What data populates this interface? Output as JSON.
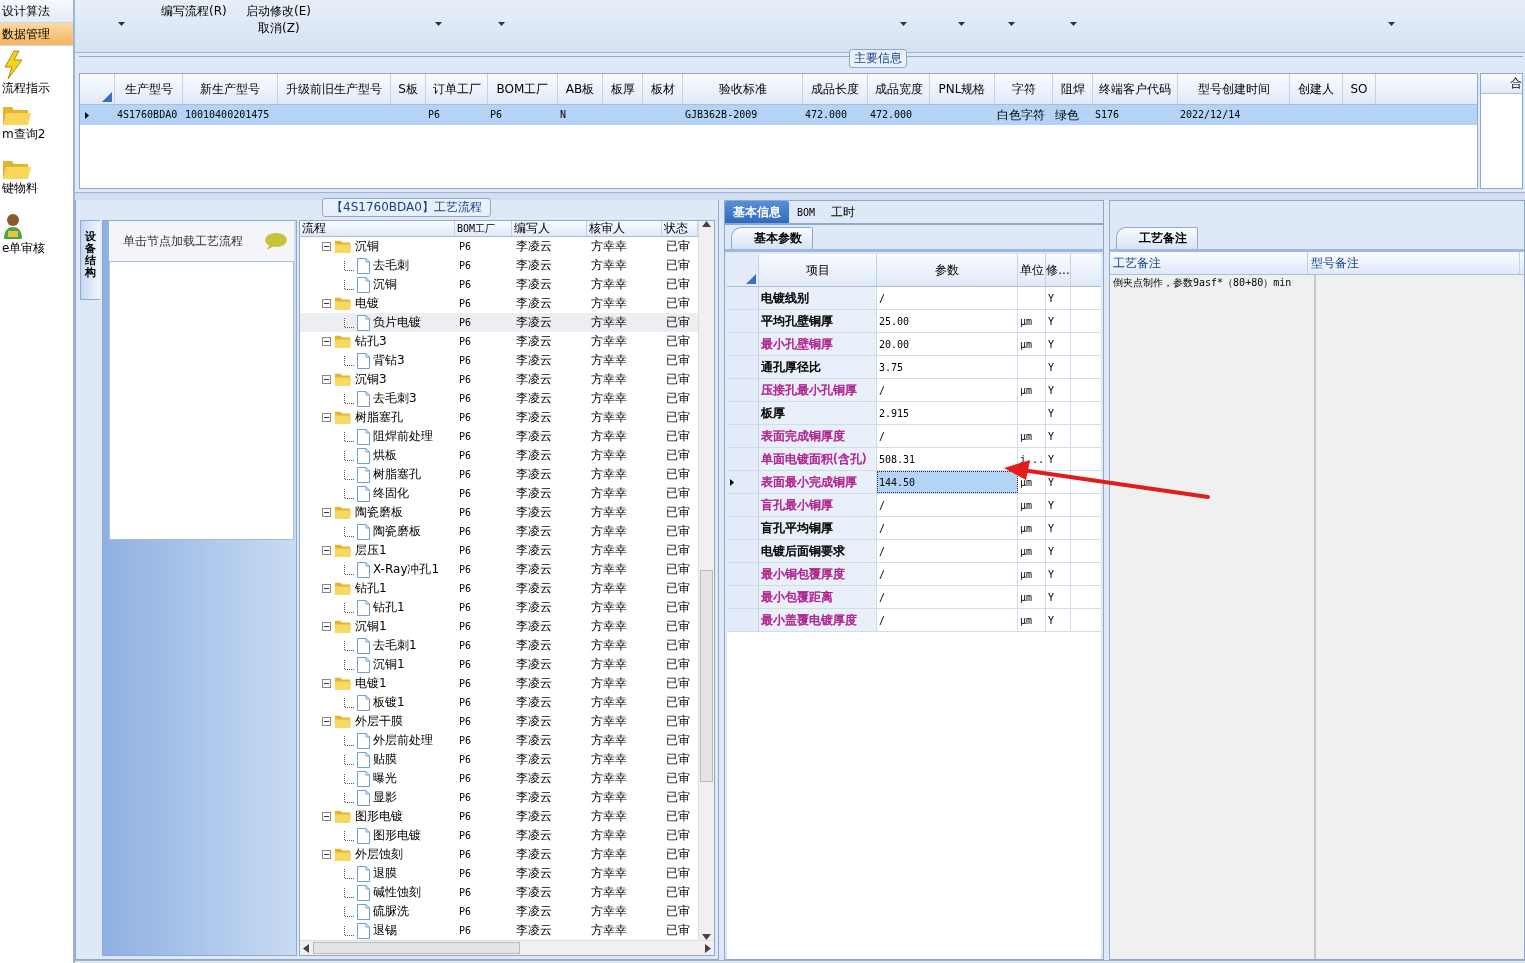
{
  "sidebar": {
    "items": [
      {
        "label": "设计算法",
        "kind": "text",
        "selected": false
      },
      {
        "label": "数据管理",
        "kind": "text",
        "selected": true
      },
      {
        "label": "流程指示",
        "kind": "lightning",
        "selected": false
      },
      {
        "label": "m查询2",
        "kind": "folder",
        "selected": false
      },
      {
        "label": "键物料",
        "kind": "folder",
        "selected": false
      },
      {
        "label": "e单审核",
        "kind": "person",
        "selected": false
      }
    ]
  },
  "toolbar": {
    "buttons": [
      {
        "label": "编写流程(R)"
      },
      {
        "label": "启动修改(E)"
      },
      {
        "label": "取消(Z)"
      }
    ]
  },
  "main_info": {
    "title": "主要信息",
    "columns": [
      "生产型号",
      "新生产型号",
      "升级前旧生产型号",
      "S板",
      "订单工厂",
      "BOM工厂",
      "AB板",
      "板厚",
      "板材",
      "验收标准",
      "成品长度",
      "成品宽度",
      "PNL规格",
      "字符",
      "阻焊",
      "终端客户代码",
      "型号创建时间",
      "创建人",
      "SO"
    ],
    "rows": [
      {
        "selected": true,
        "cells": [
          "4S1760BDA0",
          "10010400201475",
          "",
          "",
          "P6",
          "P6",
          "N",
          "",
          "",
          "GJB362B-2009",
          "472.000",
          "472.000",
          "",
          "白色字符",
          "绿色",
          "S176",
          "2022/12/14",
          "",
          ""
        ]
      }
    ],
    "side_header": "合"
  },
  "flow": {
    "title": "【4S1760BDA0】工艺流程",
    "side_tab": "设备结构",
    "hint": "单击节点加载工艺流程",
    "columns": [
      "流程",
      "BOM工厂",
      "编写人",
      "核审人",
      "状态"
    ],
    "nodes": [
      {
        "name": "沉铜",
        "bom": "P6",
        "writer": "李凌云",
        "reviewer": "方幸幸",
        "status": "已审",
        "expanded": true,
        "selected": false,
        "children": [
          {
            "name": "去毛刺",
            "bom": "P6",
            "writer": "李凌云",
            "reviewer": "方幸幸",
            "status": "已审",
            "selected": false
          },
          {
            "name": "沉铜",
            "bom": "P6",
            "writer": "李凌云",
            "reviewer": "方幸幸",
            "status": "已审",
            "selected": false
          }
        ]
      },
      {
        "name": "电镀",
        "bom": "P6",
        "writer": "李凌云",
        "reviewer": "方幸幸",
        "status": "已审",
        "expanded": true,
        "selected": false,
        "children": [
          {
            "name": "负片电镀",
            "bom": "P6",
            "writer": "李凌云",
            "reviewer": "方幸幸",
            "status": "已审",
            "selected": true
          }
        ]
      },
      {
        "name": "钻孔3",
        "bom": "P6",
        "writer": "李凌云",
        "reviewer": "方幸幸",
        "status": "已审",
        "expanded": true,
        "selected": false,
        "children": [
          {
            "name": "背钻3",
            "bom": "P6",
            "writer": "李凌云",
            "reviewer": "方幸幸",
            "status": "已审",
            "selected": false
          }
        ]
      },
      {
        "name": "沉铜3",
        "bom": "P6",
        "writer": "李凌云",
        "reviewer": "方幸幸",
        "status": "已审",
        "expanded": true,
        "selected": false,
        "children": [
          {
            "name": "去毛刺3",
            "bom": "P6",
            "writer": "李凌云",
            "reviewer": "方幸幸",
            "status": "已审",
            "selected": false
          }
        ]
      },
      {
        "name": "树脂塞孔",
        "bom": "P6",
        "writer": "李凌云",
        "reviewer": "方幸幸",
        "status": "已审",
        "expanded": true,
        "selected": false,
        "children": [
          {
            "name": "阻焊前处理",
            "bom": "P6",
            "writer": "李凌云",
            "reviewer": "方幸幸",
            "status": "已审",
            "selected": false
          },
          {
            "name": "烘板",
            "bom": "P6",
            "writer": "李凌云",
            "reviewer": "方幸幸",
            "status": "已审",
            "selected": false
          },
          {
            "name": "树脂塞孔",
            "bom": "P6",
            "writer": "李凌云",
            "reviewer": "方幸幸",
            "status": "已审",
            "selected": false
          },
          {
            "name": "终固化",
            "bom": "P6",
            "writer": "李凌云",
            "reviewer": "方幸幸",
            "status": "已审",
            "selected": false
          }
        ]
      },
      {
        "name": "陶瓷磨板",
        "bom": "P6",
        "writer": "李凌云",
        "reviewer": "方幸幸",
        "status": "已审",
        "expanded": true,
        "selected": false,
        "children": [
          {
            "name": "陶瓷磨板",
            "bom": "P6",
            "writer": "李凌云",
            "reviewer": "方幸幸",
            "status": "已审",
            "selected": false
          }
        ]
      },
      {
        "name": "层压1",
        "bom": "P6",
        "writer": "李凌云",
        "reviewer": "方幸幸",
        "status": "已审",
        "expanded": true,
        "selected": false,
        "children": [
          {
            "name": "X-Ray冲孔1",
            "bom": "P6",
            "writer": "李凌云",
            "reviewer": "方幸幸",
            "status": "已审",
            "selected": false
          }
        ]
      },
      {
        "name": "钻孔1",
        "bom": "P6",
        "writer": "李凌云",
        "reviewer": "方幸幸",
        "status": "已审",
        "expanded": true,
        "selected": false,
        "children": [
          {
            "name": "钻孔1",
            "bom": "P6",
            "writer": "李凌云",
            "reviewer": "方幸幸",
            "status": "已审",
            "selected": false
          }
        ]
      },
      {
        "name": "沉铜1",
        "bom": "P6",
        "writer": "李凌云",
        "reviewer": "方幸幸",
        "status": "已审",
        "expanded": true,
        "selected": false,
        "children": [
          {
            "name": "去毛刺1",
            "bom": "P6",
            "writer": "李凌云",
            "reviewer": "方幸幸",
            "status": "已审",
            "selected": false
          },
          {
            "name": "沉铜1",
            "bom": "P6",
            "writer": "李凌云",
            "reviewer": "方幸幸",
            "status": "已审",
            "selected": false
          }
        ]
      },
      {
        "name": "电镀1",
        "bom": "P6",
        "writer": "李凌云",
        "reviewer": "方幸幸",
        "status": "已审",
        "expanded": true,
        "selected": false,
        "children": [
          {
            "name": "板镀1",
            "bom": "P6",
            "writer": "李凌云",
            "reviewer": "方幸幸",
            "status": "已审",
            "selected": false
          }
        ]
      },
      {
        "name": "外层干膜",
        "bom": "P6",
        "writer": "李凌云",
        "reviewer": "方幸幸",
        "status": "已审",
        "expanded": true,
        "selected": false,
        "children": [
          {
            "name": "外层前处理",
            "bom": "P6",
            "writer": "李凌云",
            "reviewer": "方幸幸",
            "status": "已审",
            "selected": false
          },
          {
            "name": "贴膜",
            "bom": "P6",
            "writer": "李凌云",
            "reviewer": "方幸幸",
            "status": "已审",
            "selected": false
          },
          {
            "name": "曝光",
            "bom": "P6",
            "writer": "李凌云",
            "reviewer": "方幸幸",
            "status": "已审",
            "selected": false
          },
          {
            "name": "显影",
            "bom": "P6",
            "writer": "李凌云",
            "reviewer": "方幸幸",
            "status": "已审",
            "selected": false
          }
        ]
      },
      {
        "name": "图形电镀",
        "bom": "P6",
        "writer": "李凌云",
        "reviewer": "方幸幸",
        "status": "已审",
        "expanded": true,
        "selected": false,
        "children": [
          {
            "name": "图形电镀",
            "bom": "P6",
            "writer": "李凌云",
            "reviewer": "方幸幸",
            "status": "已审",
            "selected": false
          }
        ]
      },
      {
        "name": "外层蚀刻",
        "bom": "P6",
        "writer": "李凌云",
        "reviewer": "方幸幸",
        "status": "已审",
        "expanded": true,
        "selected": false,
        "children": [
          {
            "name": "退膜",
            "bom": "P6",
            "writer": "李凌云",
            "reviewer": "方幸幸",
            "status": "已审",
            "selected": false
          },
          {
            "name": "碱性蚀刻",
            "bom": "P6",
            "writer": "李凌云",
            "reviewer": "方幸幸",
            "status": "已审",
            "selected": false
          },
          {
            "name": "硫脲洗",
            "bom": "P6",
            "writer": "李凌云",
            "reviewer": "方幸幸",
            "status": "已审",
            "selected": false
          },
          {
            "name": "退锡",
            "bom": "P6",
            "writer": "李凌云",
            "reviewer": "方幸幸",
            "status": "已审",
            "selected": false
          }
        ]
      }
    ]
  },
  "detail": {
    "tabs": [
      {
        "label": "基本信息",
        "selected": true
      },
      {
        "label": "BOM",
        "selected": false
      },
      {
        "label": "工时",
        "selected": false
      }
    ],
    "subtab": "基本参数",
    "columns": [
      "项目",
      "参数",
      "单位",
      "修..."
    ],
    "rows": [
      {
        "item": "电镀线别",
        "color": "#000000",
        "value": "/",
        "unit": "",
        "flag": "Y",
        "selected": false
      },
      {
        "item": "平均孔壁铜厚",
        "color": "#000000",
        "value": "25.00",
        "unit": "μm",
        "flag": "Y",
        "selected": false
      },
      {
        "item": "最小孔壁铜厚",
        "color": "#b01e8c",
        "value": "20.00",
        "unit": "μm",
        "flag": "Y",
        "selected": false
      },
      {
        "item": "通孔厚径比",
        "color": "#000000",
        "value": "3.75",
        "unit": "",
        "flag": "Y",
        "selected": false
      },
      {
        "item": "压接孔最小孔铜厚",
        "color": "#b01e8c",
        "value": "/",
        "unit": "μm",
        "flag": "Y",
        "selected": false
      },
      {
        "item": "板厚",
        "color": "#000000",
        "value": "2.915",
        "unit": "",
        "flag": "Y",
        "selected": false
      },
      {
        "item": "表面完成铜厚度",
        "color": "#b01e8c",
        "value": "/",
        "unit": "μm",
        "flag": "Y",
        "selected": false
      },
      {
        "item": "单面电镀面积(含孔)",
        "color": "#b01e8c",
        "value": "508.31",
        "unit": "i...",
        "flag": "Y",
        "selected": false
      },
      {
        "item": "表面最小完成铜厚",
        "color": "#b01e8c",
        "value": "144.50",
        "unit": "μm",
        "flag": "Y",
        "selected": true
      },
      {
        "item": "盲孔最小铜厚",
        "color": "#b01e8c",
        "value": "/",
        "unit": "μm",
        "flag": "Y",
        "selected": false
      },
      {
        "item": "盲孔平均铜厚",
        "color": "#000000",
        "value": "/",
        "unit": "μm",
        "flag": "Y",
        "selected": false
      },
      {
        "item": "电镀后面铜要求",
        "color": "#000000",
        "value": "/",
        "unit": "μm",
        "flag": "Y",
        "selected": false
      },
      {
        "item": "最小铜包覆厚度",
        "color": "#b01e8c",
        "value": "/",
        "unit": "μm",
        "flag": "Y",
        "selected": false
      },
      {
        "item": "最小包覆距离",
        "color": "#b01e8c",
        "value": "/",
        "unit": "μm",
        "flag": "Y",
        "selected": false
      },
      {
        "item": "最小盖覆电镀厚度",
        "color": "#b01e8c",
        "value": "/",
        "unit": "μm",
        "flag": "Y",
        "selected": false
      }
    ]
  },
  "notes": {
    "tab": "工艺备注",
    "columns": [
      "工艺备注",
      "型号备注"
    ],
    "text": "倒夹点制作，参数9asf*（80+80）min"
  }
}
